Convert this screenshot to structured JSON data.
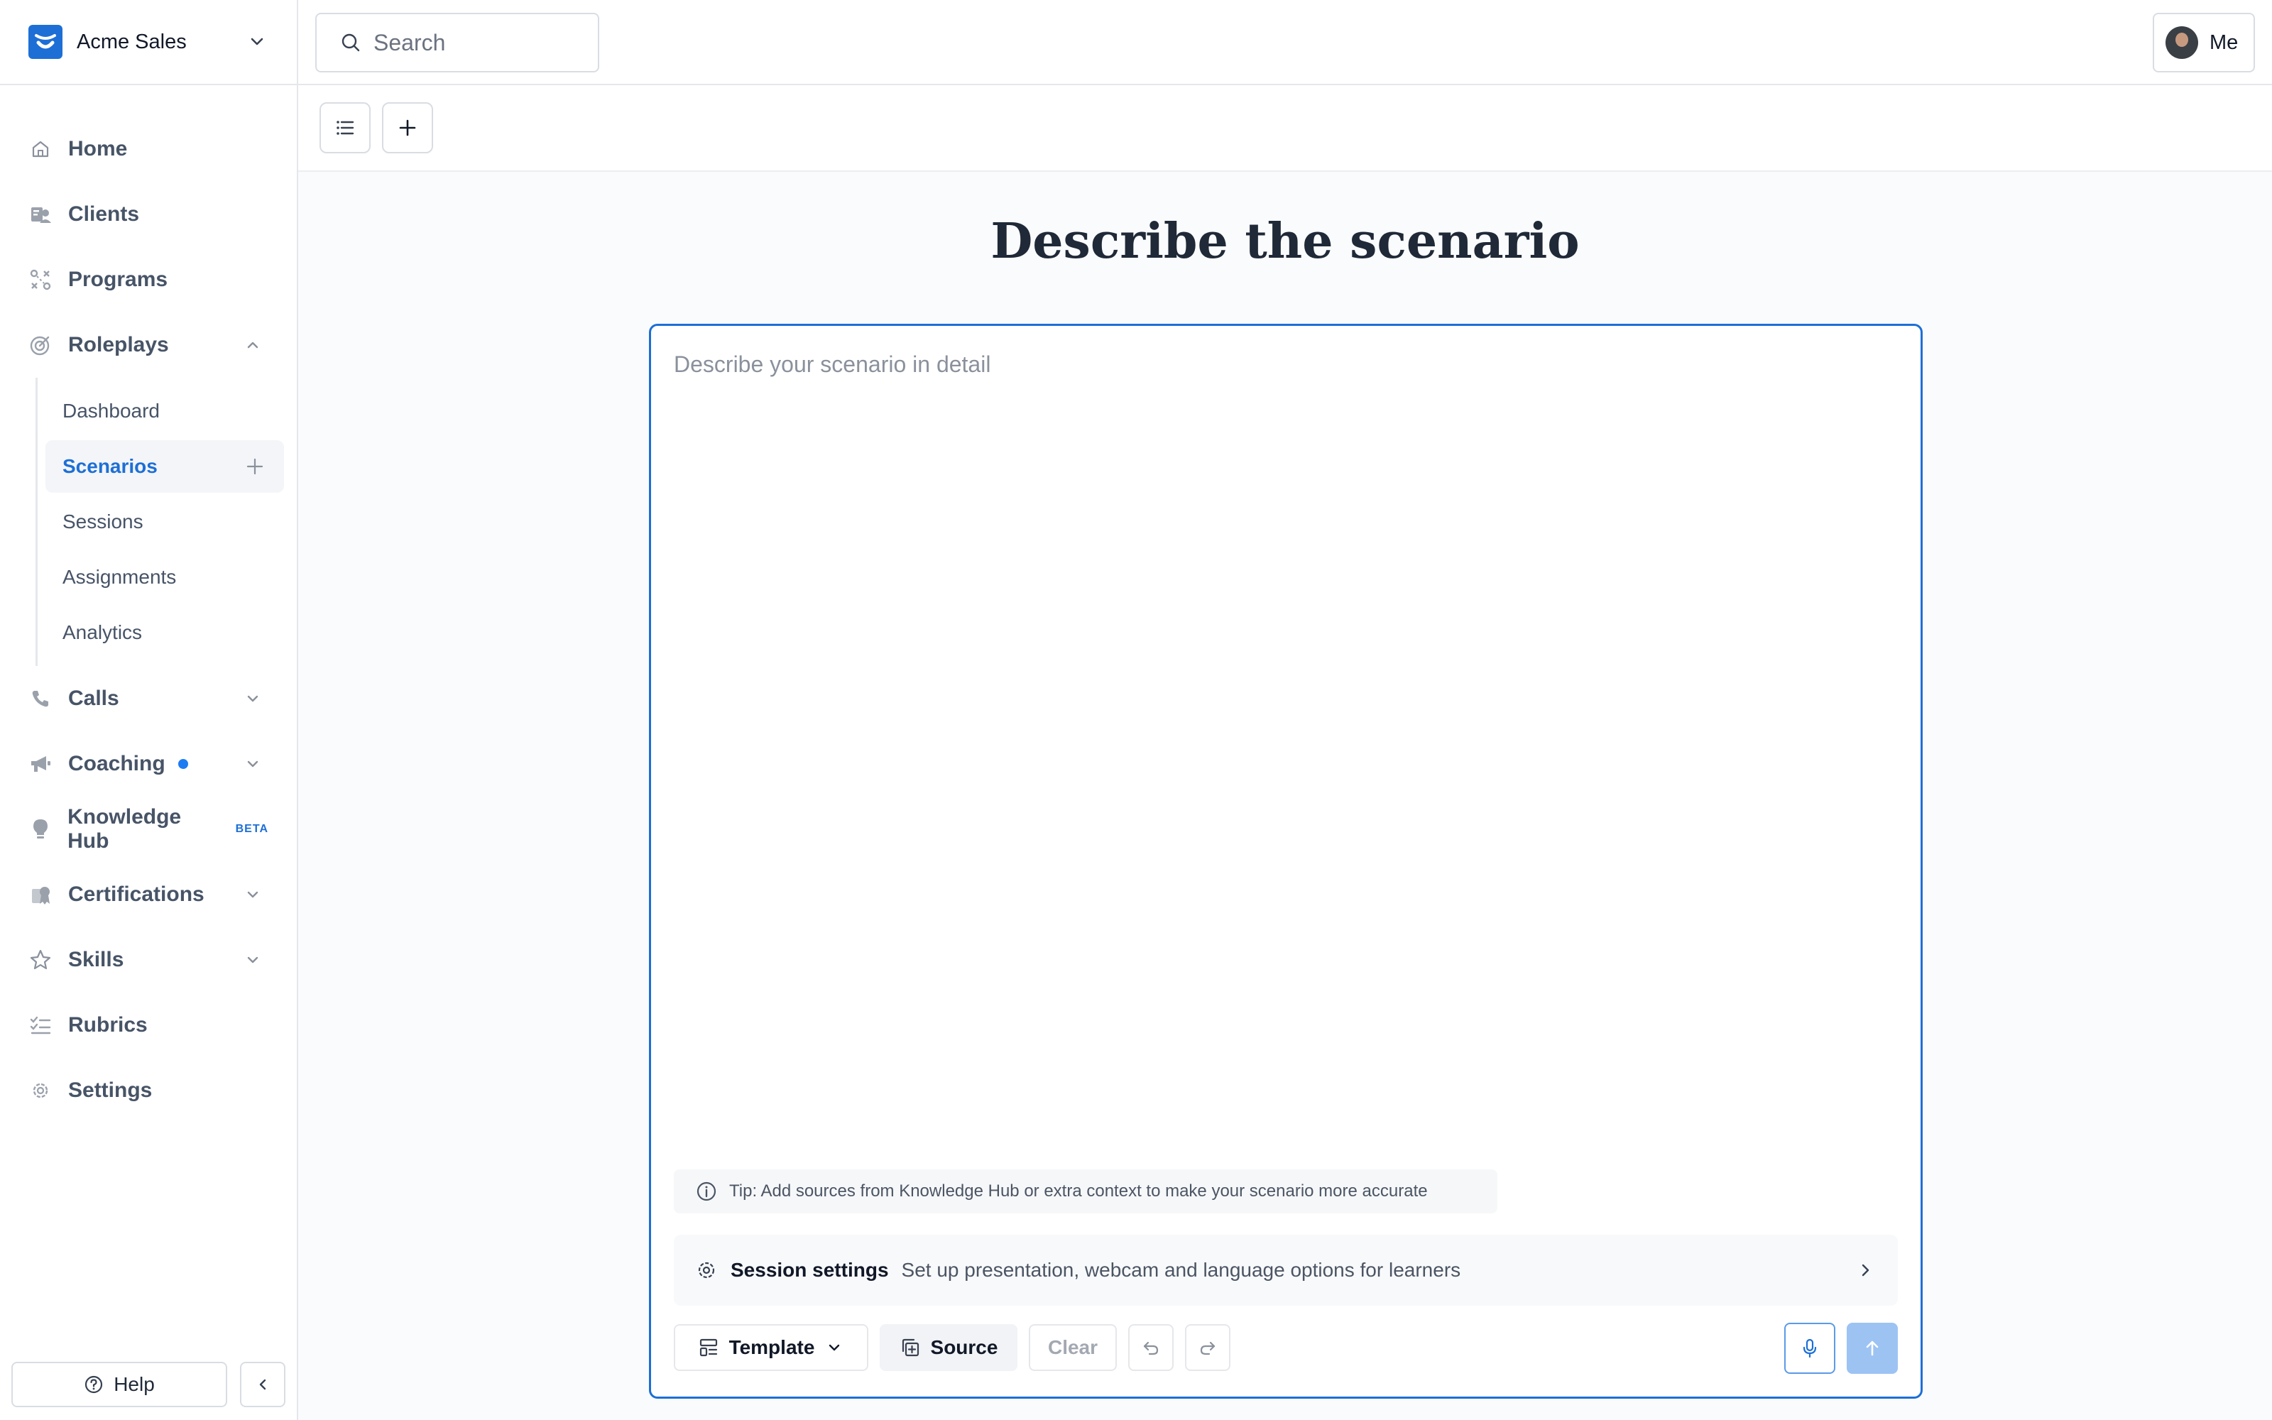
{
  "org": {
    "name": "Acme Sales"
  },
  "search": {
    "placeholder": "Search"
  },
  "user": {
    "label": "Me"
  },
  "nav": {
    "home": "Home",
    "clients": "Clients",
    "programs": "Programs",
    "roleplays": "Roleplays",
    "roleplays_sub": {
      "dashboard": "Dashboard",
      "scenarios": "Scenarios",
      "sessions": "Sessions",
      "assignments": "Assignments",
      "analytics": "Analytics"
    },
    "calls": "Calls",
    "coaching": "Coaching",
    "knowledge_hub": "Knowledge Hub",
    "knowledge_hub_badge": "BETA",
    "certifications": "Certifications",
    "skills": "Skills",
    "rubrics": "Rubrics",
    "settings": "Settings"
  },
  "footer": {
    "help": "Help"
  },
  "page": {
    "title": "Describe the scenario",
    "editor_placeholder": "Describe your scenario in detail",
    "tip": "Tip: Add sources from Knowledge Hub or extra context to make your scenario more accurate",
    "session_title": "Session settings",
    "session_desc": "Set up presentation, webcam and language options for learners"
  },
  "actions": {
    "template": "Template",
    "source": "Source",
    "clear": "Clear"
  },
  "colors": {
    "accent": "#1d6fd6",
    "notification_dot": "#1d7cf2",
    "send_disabled": "#9dc3f3"
  }
}
